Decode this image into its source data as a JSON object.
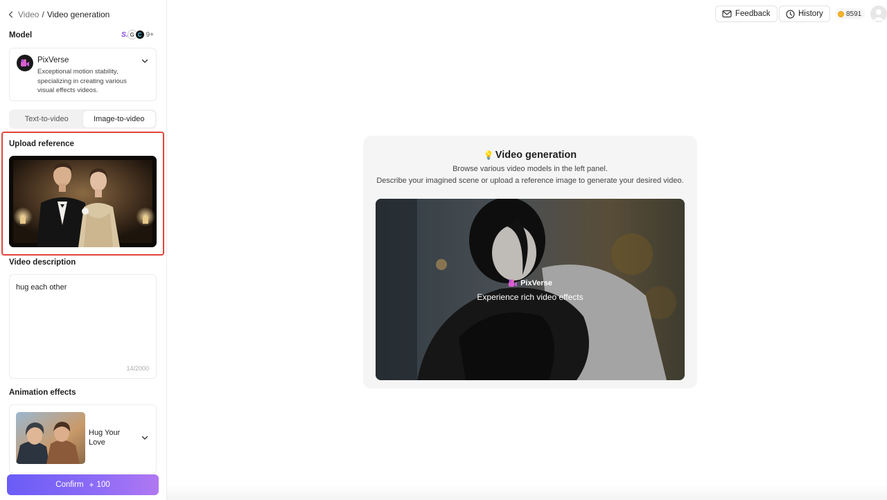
{
  "breadcrumb": {
    "parent": "Video",
    "separator": "/",
    "current": "Video generation"
  },
  "model": {
    "label": "Model",
    "badges": {
      "s": "S.",
      "more": "9+"
    },
    "name": "PixVerse",
    "description": "Exceptional motion stability, specializing in creating various visual effects videos."
  },
  "mode_tabs": [
    {
      "label": "Text-to-video",
      "active": false
    },
    {
      "label": "Image-to-video",
      "active": true
    }
  ],
  "upload": {
    "label": "Upload reference"
  },
  "description": {
    "label": "Video description",
    "value": "hug each other",
    "counter": "14/2000"
  },
  "animation": {
    "label": "Animation effects",
    "effect_name": "Hug Your Love"
  },
  "confirm": {
    "label": "Confirm",
    "plus": "+",
    "cost": "100"
  },
  "topbar": {
    "feedback": "Feedback",
    "history": "History",
    "credits": "8591"
  },
  "main": {
    "title": "Video generation",
    "subtitle1": "Browse various video models in the left panel.",
    "subtitle2": "Describe your imagined scene or upload a reference image to generate your desired video.",
    "preview_brand": "PixVerse",
    "preview_caption": "Experience rich video effects"
  },
  "colors": {
    "accent": "#6a5cf6",
    "highlight_border": "#e0443a",
    "coin": "#f5b428"
  },
  "icons": {
    "back": "chevron-left-icon",
    "chevron": "chevron-down-icon",
    "feedback": "mail-icon",
    "history": "clock-icon",
    "coin": "coin-icon",
    "brand": "pixverse-logo-icon"
  }
}
